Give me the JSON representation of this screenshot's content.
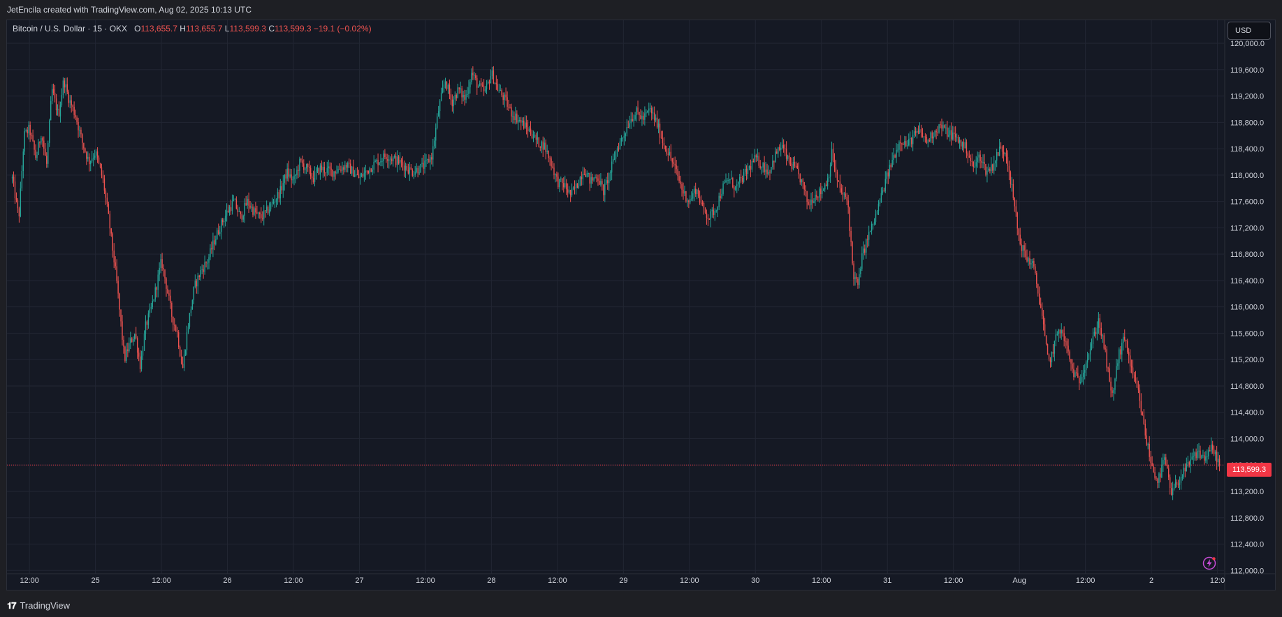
{
  "header": {
    "attribution": "JetEncila created with TradingView.com, Aug 02, 2025 10:13 UTC"
  },
  "legend": {
    "symbol": "Bitcoin / U.S. Dollar · 15 · OKX",
    "open_label": "O",
    "open": "113,655.7",
    "high_label": "H",
    "high": "113,655.7",
    "low_label": "L",
    "low": "113,599.3",
    "close_label": "C",
    "close": "113,599.3",
    "change": "−19.1 (−0.02%)"
  },
  "currency_button": "USD",
  "last_price_label": "113,599.3",
  "footer": {
    "brand": "TradingView",
    "logo_icon": "tradingview-logo-icon"
  },
  "icons": {
    "alert": "lightning-bolt-icon"
  },
  "colors": {
    "up": "#26a69a",
    "down": "#ef5350",
    "last_price": "#f23645",
    "background": "#151924",
    "grid": "#222633"
  },
  "chart_data": {
    "type": "candlestick",
    "symbol": "Bitcoin / U.S. Dollar",
    "interval": "15",
    "exchange": "OKX",
    "ylim": [
      111950,
      120350
    ],
    "y_ticks": [
      112000,
      112400,
      112800,
      113200,
      113600,
      114000,
      114400,
      114800,
      115200,
      115600,
      116000,
      116400,
      116800,
      117200,
      117600,
      118000,
      118400,
      118800,
      119200,
      119600,
      120000
    ],
    "y_tick_labels": [
      "112,000.0",
      "112,400.0",
      "112,800.0",
      "113,200.0",
      "113,600.0",
      "114,000.0",
      "114,400.0",
      "114,800.0",
      "115,200.0",
      "115,600.0",
      "116,000.0",
      "116,400.0",
      "116,800.0",
      "117,200.0",
      "117,600.0",
      "118,000.0",
      "118,400.0",
      "118,800.0",
      "119,200.0",
      "119,600.0",
      "120,000.0"
    ],
    "x_ticks": [
      {
        "t": 0.0,
        "label": "12:00"
      },
      {
        "t": 0.5,
        "label": "25"
      },
      {
        "t": 1.0,
        "label": "12:00"
      },
      {
        "t": 1.5,
        "label": "26"
      },
      {
        "t": 2.0,
        "label": "12:00"
      },
      {
        "t": 2.5,
        "label": "27"
      },
      {
        "t": 3.0,
        "label": "12:00"
      },
      {
        "t": 3.5,
        "label": "28"
      },
      {
        "t": 4.0,
        "label": "12:00"
      },
      {
        "t": 4.5,
        "label": "29"
      },
      {
        "t": 5.0,
        "label": "12:00"
      },
      {
        "t": 5.5,
        "label": "30"
      },
      {
        "t": 6.0,
        "label": "12:00"
      },
      {
        "t": 6.5,
        "label": "31"
      },
      {
        "t": 7.0,
        "label": "12:00"
      },
      {
        "t": 7.5,
        "label": "Aug"
      },
      {
        "t": 8.0,
        "label": "12:00"
      },
      {
        "t": 8.5,
        "label": "2"
      },
      {
        "t": 9.0,
        "label": "12:0"
      }
    ],
    "x_range_days": [
      -0.17,
      9.05
    ],
    "last_price": 113599.3,
    "close_path": [
      [
        -0.13,
        117950
      ],
      [
        -0.08,
        117350
      ],
      [
        -0.04,
        118600
      ],
      [
        0.0,
        118700
      ],
      [
        0.05,
        118250
      ],
      [
        0.09,
        118650
      ],
      [
        0.13,
        118150
      ],
      [
        0.17,
        119300
      ],
      [
        0.22,
        118900
      ],
      [
        0.26,
        119450
      ],
      [
        0.3,
        119150
      ],
      [
        0.35,
        118900
      ],
      [
        0.4,
        118500
      ],
      [
        0.45,
        118200
      ],
      [
        0.5,
        118350
      ],
      [
        0.56,
        117900
      ],
      [
        0.61,
        117200
      ],
      [
        0.66,
        116400
      ],
      [
        0.69,
        115800
      ],
      [
        0.72,
        115200
      ],
      [
        0.76,
        115450
      ],
      [
        0.8,
        115600
      ],
      [
        0.84,
        115100
      ],
      [
        0.88,
        115700
      ],
      [
        0.92,
        115950
      ],
      [
        0.96,
        116300
      ],
      [
        1.0,
        116700
      ],
      [
        1.04,
        116300
      ],
      [
        1.08,
        115850
      ],
      [
        1.12,
        115600
      ],
      [
        1.16,
        115050
      ],
      [
        1.2,
        115700
      ],
      [
        1.25,
        116300
      ],
      [
        1.3,
        116550
      ],
      [
        1.35,
        116700
      ],
      [
        1.4,
        117000
      ],
      [
        1.45,
        117250
      ],
      [
        1.5,
        117450
      ],
      [
        1.55,
        117600
      ],
      [
        1.6,
        117350
      ],
      [
        1.65,
        117600
      ],
      [
        1.7,
        117450
      ],
      [
        1.75,
        117350
      ],
      [
        1.8,
        117450
      ],
      [
        1.85,
        117600
      ],
      [
        1.9,
        117750
      ],
      [
        1.95,
        118050
      ],
      [
        2.0,
        117900
      ],
      [
        2.05,
        118200
      ],
      [
        2.1,
        118100
      ],
      [
        2.15,
        117950
      ],
      [
        2.2,
        118100
      ],
      [
        2.3,
        118050
      ],
      [
        2.4,
        118150
      ],
      [
        2.5,
        117950
      ],
      [
        2.6,
        118150
      ],
      [
        2.7,
        118300
      ],
      [
        2.8,
        118200
      ],
      [
        2.9,
        118050
      ],
      [
        3.0,
        118150
      ],
      [
        3.05,
        118300
      ],
      [
        3.1,
        119000
      ],
      [
        3.15,
        119450
      ],
      [
        3.2,
        119100
      ],
      [
        3.25,
        119300
      ],
      [
        3.3,
        119150
      ],
      [
        3.35,
        119550
      ],
      [
        3.4,
        119350
      ],
      [
        3.45,
        119250
      ],
      [
        3.5,
        119550
      ],
      [
        3.55,
        119300
      ],
      [
        3.6,
        119150
      ],
      [
        3.65,
        118950
      ],
      [
        3.7,
        118850
      ],
      [
        3.75,
        118750
      ],
      [
        3.8,
        118650
      ],
      [
        3.85,
        118500
      ],
      [
        3.9,
        118450
      ],
      [
        3.95,
        118200
      ],
      [
        4.0,
        117900
      ],
      [
        4.05,
        117850
      ],
      [
        4.1,
        117700
      ],
      [
        4.15,
        117850
      ],
      [
        4.2,
        118100
      ],
      [
        4.25,
        117900
      ],
      [
        4.3,
        118000
      ],
      [
        4.35,
        117750
      ],
      [
        4.4,
        118050
      ],
      [
        4.45,
        118400
      ],
      [
        4.5,
        118600
      ],
      [
        4.55,
        118850
      ],
      [
        4.6,
        118950
      ],
      [
        4.65,
        118850
      ],
      [
        4.7,
        119000
      ],
      [
        4.75,
        118800
      ],
      [
        4.8,
        118500
      ],
      [
        4.85,
        118300
      ],
      [
        4.9,
        118050
      ],
      [
        4.95,
        117750
      ],
      [
        5.0,
        117600
      ],
      [
        5.05,
        117800
      ],
      [
        5.1,
        117500
      ],
      [
        5.15,
        117350
      ],
      [
        5.2,
        117500
      ],
      [
        5.25,
        117800
      ],
      [
        5.3,
        117950
      ],
      [
        5.35,
        117800
      ],
      [
        5.4,
        117950
      ],
      [
        5.45,
        118100
      ],
      [
        5.5,
        118250
      ],
      [
        5.55,
        118150
      ],
      [
        5.6,
        118050
      ],
      [
        5.65,
        118300
      ],
      [
        5.7,
        118450
      ],
      [
        5.75,
        118200
      ],
      [
        5.8,
        118100
      ],
      [
        5.85,
        117900
      ],
      [
        5.9,
        117550
      ],
      [
        5.95,
        117700
      ],
      [
        6.0,
        117750
      ],
      [
        6.05,
        117950
      ],
      [
        6.08,
        118350
      ],
      [
        6.12,
        117900
      ],
      [
        6.16,
        117700
      ],
      [
        6.2,
        117600
      ],
      [
        6.24,
        116500
      ],
      [
        6.28,
        116300
      ],
      [
        6.3,
        116700
      ],
      [
        6.35,
        117050
      ],
      [
        6.4,
        117300
      ],
      [
        6.45,
        117650
      ],
      [
        6.5,
        118000
      ],
      [
        6.55,
        118300
      ],
      [
        6.6,
        118550
      ],
      [
        6.65,
        118450
      ],
      [
        6.7,
        118600
      ],
      [
        6.75,
        118650
      ],
      [
        6.8,
        118500
      ],
      [
        6.85,
        118650
      ],
      [
        6.9,
        118750
      ],
      [
        6.95,
        118650
      ],
      [
        7.0,
        118600
      ],
      [
        7.05,
        118500
      ],
      [
        7.1,
        118400
      ],
      [
        7.15,
        118100
      ],
      [
        7.2,
        118300
      ],
      [
        7.25,
        118050
      ],
      [
        7.3,
        118150
      ],
      [
        7.35,
        118400
      ],
      [
        7.4,
        118350
      ],
      [
        7.45,
        117700
      ],
      [
        7.5,
        117000
      ],
      [
        7.55,
        116750
      ],
      [
        7.6,
        116650
      ],
      [
        7.63,
        116350
      ],
      [
        7.67,
        115900
      ],
      [
        7.7,
        115400
      ],
      [
        7.72,
        115150
      ],
      [
        7.75,
        115300
      ],
      [
        7.8,
        115700
      ],
      [
        7.85,
        115450
      ],
      [
        7.9,
        115050
      ],
      [
        7.95,
        114850
      ],
      [
        8.0,
        115150
      ],
      [
        8.05,
        115450
      ],
      [
        8.1,
        115800
      ],
      [
        8.15,
        115300
      ],
      [
        8.2,
        114600
      ],
      [
        8.25,
        115250
      ],
      [
        8.3,
        115550
      ],
      [
        8.35,
        115000
      ],
      [
        8.4,
        114700
      ],
      [
        8.45,
        114100
      ],
      [
        8.5,
        113600
      ],
      [
        8.55,
        113350
      ],
      [
        8.6,
        113700
      ],
      [
        8.65,
        113150
      ],
      [
        8.7,
        113350
      ],
      [
        8.75,
        113500
      ],
      [
        8.8,
        113650
      ],
      [
        8.85,
        113800
      ],
      [
        8.9,
        113700
      ],
      [
        8.95,
        113850
      ],
      [
        9.0,
        113700
      ],
      [
        9.02,
        113599.3
      ]
    ],
    "annotations": [
      "113,599.3"
    ]
  }
}
